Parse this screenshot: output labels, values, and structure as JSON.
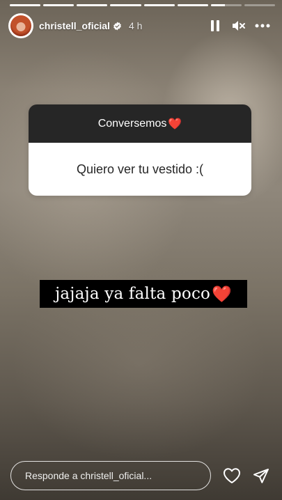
{
  "story": {
    "progress": [
      1,
      1,
      1,
      1,
      1,
      1,
      0.45,
      0
    ],
    "account": {
      "username": "christell_oficial",
      "verified": true,
      "time": "4 h"
    },
    "controls": {
      "pause_icon": "pause-icon",
      "mute_icon": "speaker-muted-icon",
      "more_icon": "more-options-icon"
    }
  },
  "question_sticker": {
    "title": "Conversemos",
    "title_emoji": "❤️",
    "question": "Quiero ver tu vestido :("
  },
  "caption": {
    "text": "jajaja ya falta poco",
    "emoji": "❤️"
  },
  "footer": {
    "reply_placeholder": "Responde a christell_oficial...",
    "like_icon": "heart-outline-icon",
    "share_icon": "send-icon"
  },
  "colors": {
    "sticker_header": "#262626",
    "sticker_body": "#ffffff",
    "caption_bg": "#000000",
    "heart": "#ff2d3a"
  }
}
